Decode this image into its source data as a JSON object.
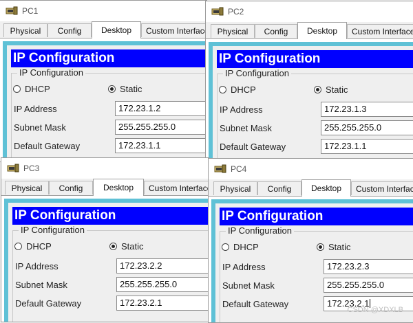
{
  "tabs": [
    "Physical",
    "Config",
    "Desktop",
    "Custom Interface"
  ],
  "windows": [
    {
      "title": "PC1",
      "panel_title": "IP Configuration",
      "group_label": "IP Configuration",
      "dhcp_label": "DHCP",
      "static_label": "Static",
      "mode": "static",
      "ip_label": "IP Address",
      "ip_value": "172.23.1.2",
      "mask_label": "Subnet Mask",
      "mask_value": "255.255.255.0",
      "gw_label": "Default Gateway",
      "gw_value": "172.23.1.1"
    },
    {
      "title": "PC2",
      "panel_title": "IP Configuration",
      "group_label": "IP Configuration",
      "dhcp_label": "DHCP",
      "static_label": "Static",
      "mode": "static",
      "ip_label": "IP Address",
      "ip_value": "172.23.1.3",
      "mask_label": "Subnet Mask",
      "mask_value": "255.255.255.0",
      "gw_label": "Default Gateway",
      "gw_value": "172.23.1.1"
    },
    {
      "title": "PC3",
      "panel_title": "IP Configuration",
      "group_label": "IP Configuration",
      "dhcp_label": "DHCP",
      "static_label": "Static",
      "mode": "static",
      "ip_label": "IP Address",
      "ip_value": "172.23.2.2",
      "mask_label": "Subnet Mask",
      "mask_value": "255.255.255.0",
      "gw_label": "Default Gateway",
      "gw_value": "172.23.2.1"
    },
    {
      "title": "PC4",
      "panel_title": "IP Configuration",
      "group_label": "IP Configuration",
      "dhcp_label": "DHCP",
      "static_label": "Static",
      "mode": "static",
      "ip_label": "IP Address",
      "ip_value": "172.23.2.3",
      "mask_label": "Subnet Mask",
      "mask_value": "255.255.255.0",
      "gw_label": "Default Gateway",
      "gw_value": "172.23.2.1"
    }
  ],
  "active_tab": "Desktop",
  "app_icon": "pc-icon",
  "accent_color": "#0000ff",
  "frame_color": "#5fc1d6",
  "watermark": "CSDN @XDXLB"
}
